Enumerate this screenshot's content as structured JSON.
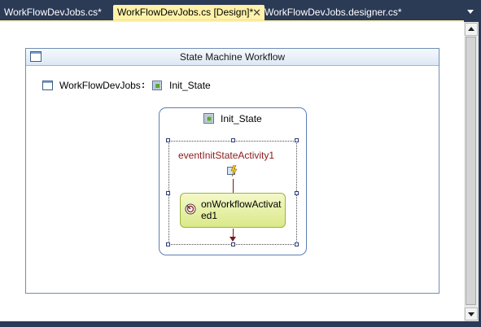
{
  "tabs": [
    {
      "label": "WorkFlowDevJobs.cs*",
      "active": false
    },
    {
      "label": "WorkFlowDevJobs.cs [Design]*",
      "active": true
    },
    {
      "label": "WorkFlowDevJobs.designer.cs*",
      "active": false
    }
  ],
  "tab_close_glyph": "✕",
  "workflow": {
    "header_title": "State Machine Workflow",
    "breadcrumb": {
      "workflow_name": "WorkFlowDevJobs",
      "separator": ":",
      "state_name": "Init_State"
    },
    "state": {
      "title": "Init_State",
      "event_activity": "eventInitStateActivity1",
      "child_activity": "onWorkflowActivated1"
    }
  },
  "icons": {
    "workflow": "workflow-window-icon",
    "state": "state-icon",
    "event": "event-driven-icon",
    "activity": "handle-external-event-icon"
  },
  "colors": {
    "chrome": "#2b3a55",
    "active_tab": "#fff2a8",
    "event_label": "#8b1a1a",
    "activity_fill": "#dbe98a",
    "state_border": "#5b7fb5"
  }
}
